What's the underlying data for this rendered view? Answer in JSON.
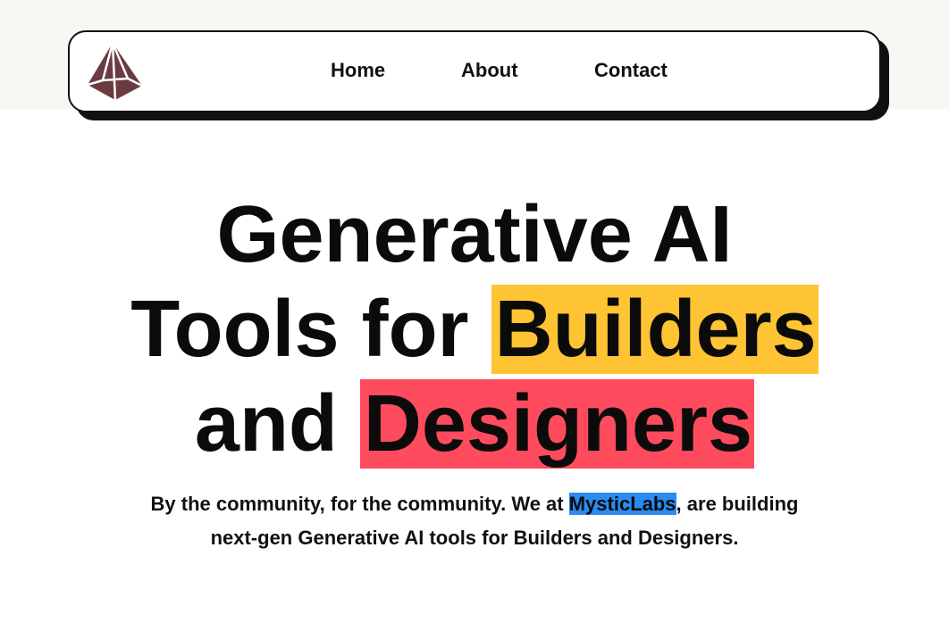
{
  "nav": {
    "logo_name": "pyramid-logo",
    "links": [
      {
        "label": "Home"
      },
      {
        "label": "About"
      },
      {
        "label": "Contact"
      }
    ]
  },
  "hero": {
    "title_line1": "Generative AI",
    "title_line2_prefix": "Tools for ",
    "title_line2_highlight": "Builders",
    "title_line3_prefix": "and ",
    "title_line3_highlight": "Designers",
    "subtitle_part1": "By the community, for the community. We at ",
    "subtitle_brand": "MysticLabs",
    "subtitle_part2": ", are building",
    "subtitle_line2": "next-gen Generative AI tools for Builders and Designers."
  },
  "colors": {
    "highlight_yellow": "#fec433",
    "highlight_red": "#ff4b5e",
    "highlight_blue": "#2a8bf2",
    "logo_color": "#6b3b42"
  }
}
